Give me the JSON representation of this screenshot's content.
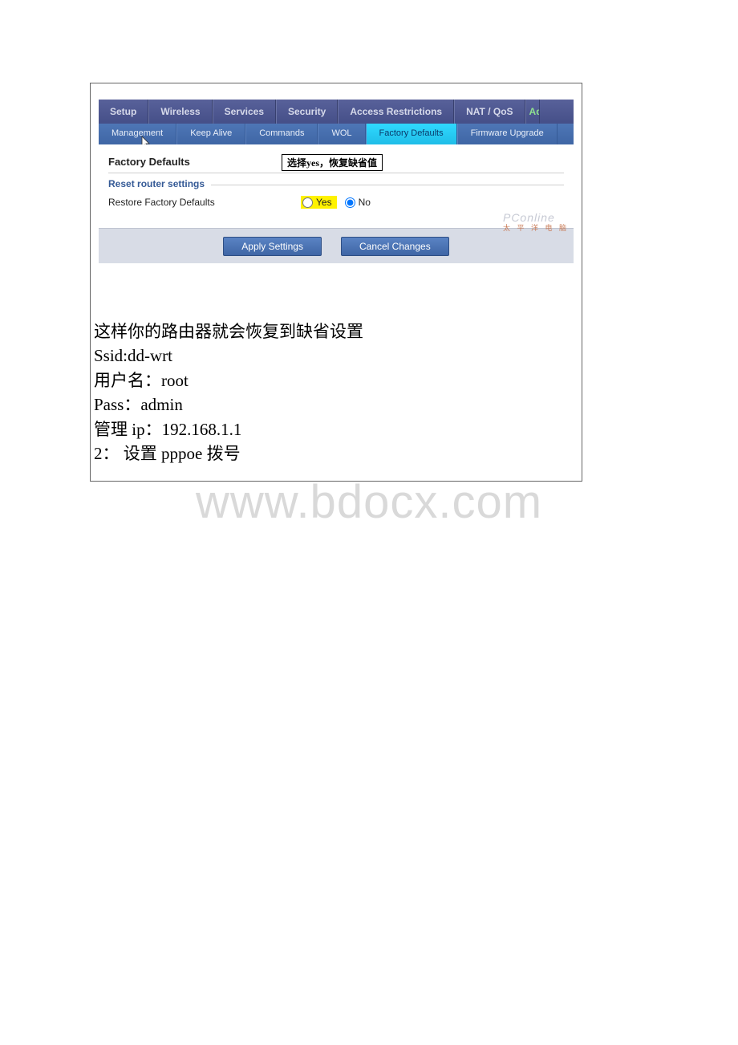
{
  "main_tabs": {
    "setup": "Setup",
    "wireless": "Wireless",
    "services": "Services",
    "security": "Security",
    "access": "Access Restrictions",
    "nat": "NAT / QoS",
    "admin_frag": "Ad"
  },
  "sub_tabs": {
    "management": "Management",
    "keep_alive": "Keep Alive",
    "commands": "Commands",
    "wol": "WOL",
    "factory_defaults": "Factory Defaults",
    "firmware": "Firmware Upgrade"
  },
  "panel": {
    "title": "Factory Defaults",
    "tooltip": "选择yes，恢复缺省值",
    "fieldset_legend": "Reset router settings",
    "row_label": "Restore Factory Defaults",
    "yes": "Yes",
    "no": "No"
  },
  "buttons": {
    "apply": "Apply Settings",
    "cancel": "Cancel Changes"
  },
  "corner_watermark": {
    "line1": "PConline",
    "line2": "太 平 洋 电 脑"
  },
  "notes": {
    "l1": "这样你的路由器就会恢复到缺省设置",
    "l2": "Ssid:dd-wrt",
    "l3": "用户名：root",
    "l4": "Pass：admin",
    "l5": "管理 ip：192.168.1.1",
    "l6": "2： 设置 pppoe 拨号"
  },
  "big_watermark": "www.bdocx.com"
}
